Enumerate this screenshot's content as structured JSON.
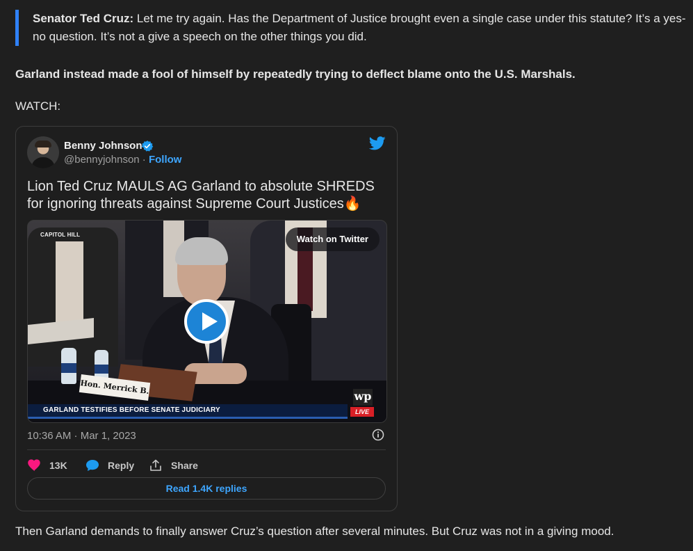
{
  "quote": {
    "speaker": "Senator Ted Cruz:",
    "text": " Let me try again. Has the Department of Justice brought even a single case under this statute? It’s a yes-no question. It’s not a give a speech on the other things you did."
  },
  "paragraph_bold": "Garland instead made a fool of himself by repeatedly trying to deflect blame onto the U.S. Marshals.",
  "watch_label": "WATCH:",
  "tweet": {
    "author_name": "Benny Johnson",
    "handle": "@bennyjohnson",
    "separator": " · ",
    "follow_label": "Follow",
    "text": "Lion Ted Cruz MAULS AG Garland to absolute SHREDS for ignoring threats against Supreme Court Justices🔥",
    "video": {
      "corner_tag": "CAPITOL HILL",
      "watch_button": "Watch on Twitter",
      "nameplate": "Hon. Merrick B. Garland",
      "chyron": "GARLAND TESTIFIES BEFORE SENATE JUDICIARY",
      "logo": "wp",
      "live": "LIVE"
    },
    "timestamp": "10:36 AM · Mar 1, 2023",
    "likes": "13K",
    "reply_label": "Reply",
    "share_label": "Share",
    "read_replies": "Read 1.4K replies"
  },
  "paragraph_bottom": "Then Garland demands to finally answer Cruz’s question after several minutes. But Cruz was not in a giving mood.",
  "colors": {
    "background": "#1f1f1f",
    "quote_bar": "#2f81f7",
    "link_blue": "#3ea6ff",
    "like_pink": "#f91880",
    "twitter_blue": "#1d9bf0"
  },
  "icons": [
    "verified-badge-icon",
    "twitter-bird-icon",
    "play-icon",
    "info-icon",
    "heart-icon",
    "reply-bubble-icon",
    "share-icon"
  ]
}
